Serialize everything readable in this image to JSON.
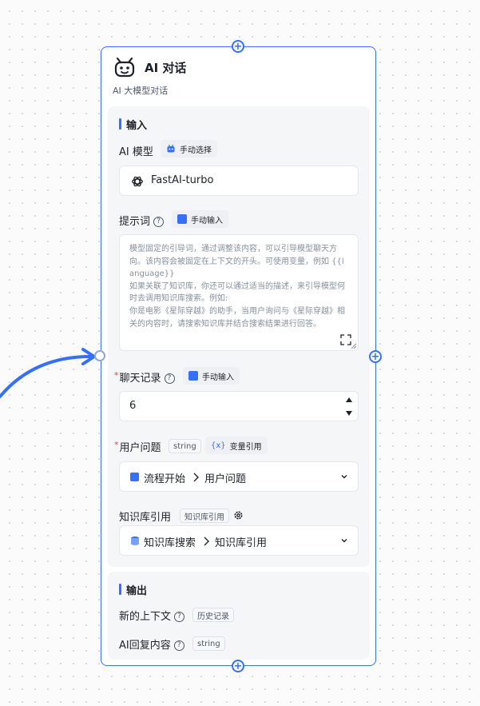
{
  "node": {
    "title": "AI 对话",
    "subtitle": "AI 大模型对话",
    "colors": {
      "accent": "#3370ff",
      "required": "#f53f3f"
    }
  },
  "input_section": {
    "title": "输入",
    "model": {
      "label": "AI 模型",
      "mode_tag": "手动选择",
      "value": "FastAI-turbo"
    },
    "prompt": {
      "label": "提示词",
      "mode_tag": "手动输入",
      "placeholder": "模型固定的引导词，通过调整该内容，可以引导模型聊天方向。该内容会被固定在上下文的开头。可使用变量，例如 {{language}}\n如果关联了知识库，你还可以通过适当的描述，来引导模型何时去调用知识库搜索。例如:\n你是电影《星际穿越》的助手，当用户询问与《星际穿越》相关的内容时，请搜索知识库并结合搜索结果进行回答。"
    },
    "history": {
      "required_mark": "*",
      "label": "聊天记录",
      "mode_tag": "手动输入",
      "value": "6"
    },
    "user_question": {
      "required_mark": "*",
      "label": "用户问题",
      "type_tag": "string",
      "mode_tag": "变量引用",
      "source": "流程开始",
      "target": "用户问题"
    },
    "knowledge": {
      "label": "知识库引用",
      "type_tag": "知识库引用",
      "source": "知识库搜索",
      "target": "知识库引用"
    }
  },
  "output_section": {
    "title": "输出",
    "items": [
      {
        "label": "新的上下文",
        "tag": "历史记录"
      },
      {
        "label": "AI回复内容",
        "tag": "string"
      }
    ]
  },
  "icons": {
    "header": "robot-face-icon",
    "model": "openai-logo-icon",
    "settings": "gear-icon"
  }
}
